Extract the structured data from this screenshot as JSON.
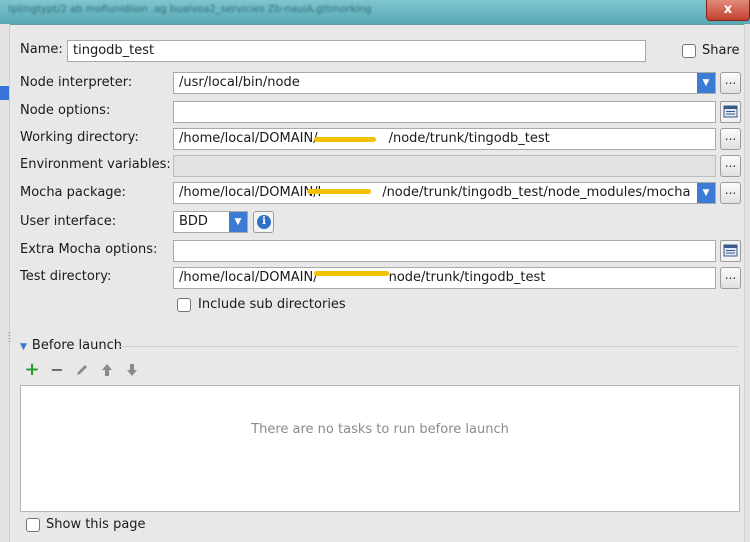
{
  "window": {
    "title": "tpl/ngtypt/2 ab mofiunidiion .ag bualvoa2_servicies Zb-nauiA.gttmorking",
    "close_label": "x"
  },
  "form": {
    "name": {
      "label": "Name:",
      "value": "tingodb_test"
    },
    "share": {
      "label": "Share",
      "checked": false
    },
    "node_interpreter": {
      "label": "Node interpreter:",
      "value": "/usr/local/bin/node"
    },
    "node_options": {
      "label": "Node options:",
      "value": ""
    },
    "working_directory": {
      "label": "Working directory:",
      "value_prefix": "/home/local/DOMAIN/",
      "value_suffix": "/node/trunk/tingodb_test"
    },
    "environment_variables": {
      "label": "Environment variables:",
      "value": ""
    },
    "mocha_package": {
      "label": "Mocha package:",
      "value_prefix": "/home/local/DOMAIN/l",
      "value_suffix": "/node/trunk/tingodb_test/node_modules/mocha"
    },
    "user_interface": {
      "label": "User interface:",
      "value": "BDD"
    },
    "extra_mocha_options": {
      "label": "Extra Mocha options:",
      "value": ""
    },
    "test_directory": {
      "label": "Test directory:",
      "value_prefix": "/home/local/DOMAIN/",
      "value_suffix": "node/trunk/tingodb_test"
    },
    "include_sub_directories": {
      "label": "Include sub directories",
      "checked": false
    }
  },
  "before_launch": {
    "title": "Before launch",
    "toolbar_icons": [
      "add-icon",
      "remove-icon",
      "edit-icon",
      "move-up-icon",
      "move-down-icon"
    ],
    "empty_text": "There are no tasks to run before launch"
  },
  "show_this_page": {
    "label": "Show this page",
    "checked": false
  },
  "colors": {
    "accent": "#3c7bd4",
    "redaction": "#f2c100",
    "add_icon": "#2e9b2e"
  }
}
